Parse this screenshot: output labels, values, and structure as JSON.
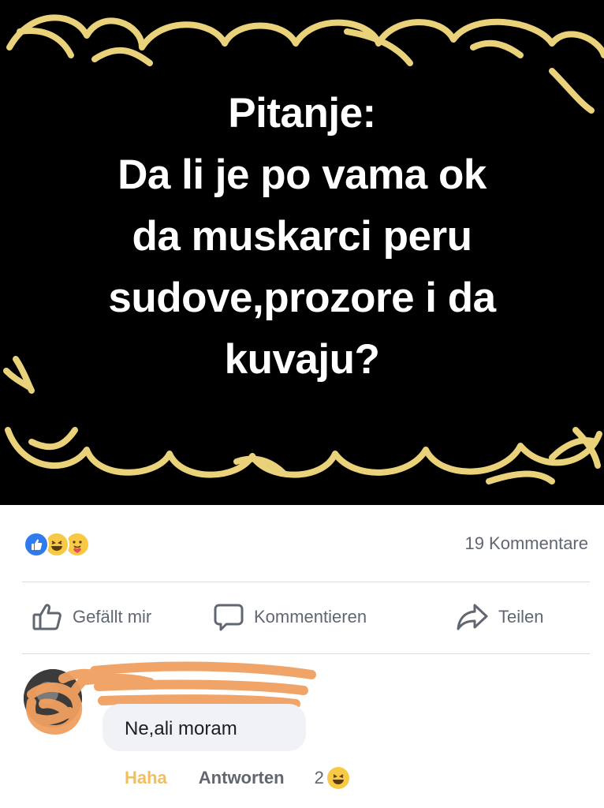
{
  "post": {
    "question_lines": [
      "Pitanje:",
      "Da li je po vama ok",
      "da muskarci peru",
      "sudove,prozore i da",
      "kuvaju?"
    ],
    "colors": {
      "background": "#000000",
      "text": "#ffffff",
      "frame": "#ead27a"
    }
  },
  "reactions": {
    "icons": [
      "like-icon",
      "haha-icon",
      "care-icon"
    ],
    "comment_count": "19 Kommentare"
  },
  "actions": {
    "like_label": "Gefällt mir",
    "comment_label": "Kommentieren",
    "share_label": "Teilen"
  },
  "comment": {
    "text": "Ne,ali moram",
    "haha_label": "Haha",
    "reply_label": "Antworten",
    "reaction_count": "2"
  }
}
